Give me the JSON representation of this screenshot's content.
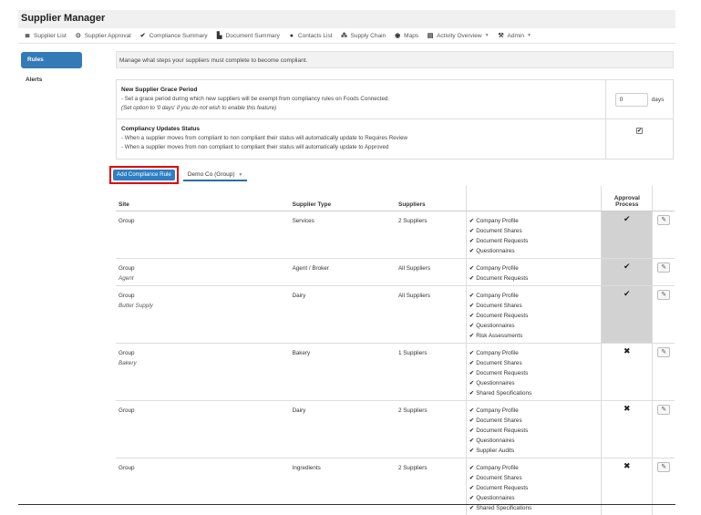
{
  "app": {
    "title": "Supplier Manager"
  },
  "nav": [
    {
      "label": "Supplier List",
      "icon": "≣",
      "icon_name": "list-icon"
    },
    {
      "label": "Supplier Approval",
      "icon": "⊙",
      "icon_name": "approval-icon"
    },
    {
      "label": "Compliance Summary",
      "icon": "✔",
      "icon_name": "check-icon"
    },
    {
      "label": "Document Summary",
      "icon": "▙",
      "icon_name": "document-icon"
    },
    {
      "label": "Contacts List",
      "icon": "●",
      "icon_name": "user-icon"
    },
    {
      "label": "Supply Chain",
      "icon": "⁂",
      "icon_name": "sitemap-icon"
    },
    {
      "label": "Maps",
      "icon": "◉",
      "icon_name": "globe-icon"
    },
    {
      "label": "Activity Overview",
      "icon": "▤",
      "icon_name": "calendar-icon",
      "caret": "▼"
    },
    {
      "label": "Admin",
      "icon": "⚒",
      "icon_name": "wrench-icon",
      "caret": "▼"
    }
  ],
  "sidebar": {
    "active": "Rules",
    "items": [
      "Alerts"
    ]
  },
  "intro": "Manage what steps your suppliers must complete to become compliant.",
  "settings": {
    "grace": {
      "title": "New Supplier Grace Period",
      "desc": "- Set a grace period during which new suppliers will be exempt from compliancy rules on Foods Connected.",
      "note": "(Set option to '0 days' if you do not wish to enable this feature)",
      "value": "0",
      "unit": "days"
    },
    "status": {
      "title": "Compliancy Updates Status",
      "line1": "- When a supplier moves from compliant to non compliant their status will automatically update to Requires Review",
      "line2": "- When a supplier moves from non compliant to compliant their status will automatically update to Approved",
      "checked": true
    }
  },
  "actions": {
    "add_label": "Add Compliance Rule",
    "company": "Demo Co (Group)",
    "caret": "▼"
  },
  "table": {
    "headers": {
      "site": "Site",
      "type": "Supplier Type",
      "suppliers": "Suppliers",
      "approval": "Approval Process"
    },
    "rows": [
      {
        "site": "Group",
        "sub": "",
        "type": "Services",
        "suppliers": "2 Suppliers",
        "items": [
          "Company Profile",
          "Document Shares",
          "Document Requests",
          "Questionnaires"
        ],
        "approval": "✔",
        "approval_on": true
      },
      {
        "site": "Group",
        "sub": "Agent",
        "type": "Agent / Broker",
        "suppliers": "All Suppliers",
        "items": [
          "Company Profile",
          "Document Requests"
        ],
        "approval": "✔",
        "approval_on": true
      },
      {
        "site": "Group",
        "sub": "Butter Supply",
        "type": "Dairy",
        "suppliers": "All Suppliers",
        "items": [
          "Company Profile",
          "Document Shares",
          "Document Requests",
          "Questionnaires",
          "Risk Assessments"
        ],
        "approval": "✔",
        "approval_on": true
      },
      {
        "site": "Group",
        "sub": "Bakery",
        "type": "Bakery",
        "suppliers": "1 Suppliers",
        "items": [
          "Company Profile",
          "Document Shares",
          "Document Requests",
          "Questionnaires",
          "Shared Specifications"
        ],
        "approval": "✖",
        "approval_on": false
      },
      {
        "site": "Group",
        "sub": "",
        "type": "Dairy",
        "suppliers": "2 Suppliers",
        "items": [
          "Company Profile",
          "Document Shares",
          "Document Requests",
          "Questionnaires",
          "Supplier Audits"
        ],
        "approval": "✖",
        "approval_on": false
      },
      {
        "site": "Group",
        "sub": "",
        "type": "Ingredients",
        "suppliers": "2 Suppliers",
        "items": [
          "Company Profile",
          "Document Shares",
          "Document Requests",
          "Questionnaires",
          "Shared Specifications"
        ],
        "approval": "✖",
        "approval_on": false
      }
    ]
  },
  "icons": {
    "check": "✔",
    "edit": "✎"
  },
  "colors": {
    "accent": "#337ab7",
    "highlight_border": "#e00000",
    "approval_bg": "#d2d2d2"
  }
}
